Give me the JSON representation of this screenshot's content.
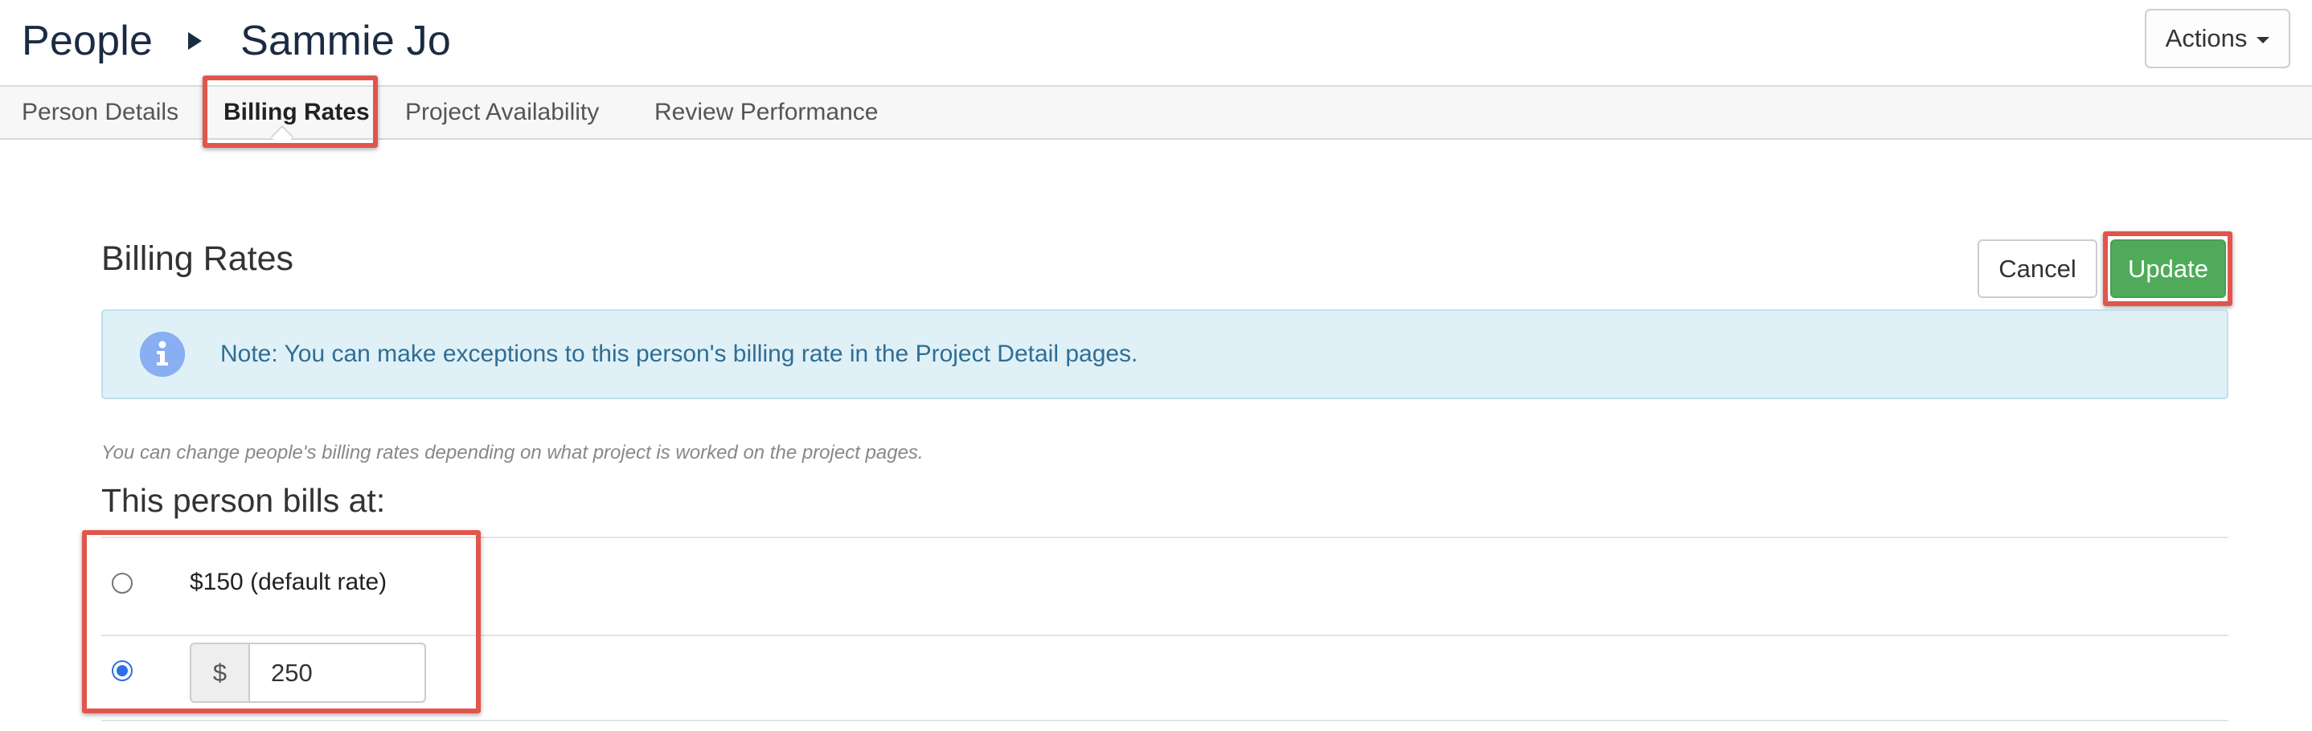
{
  "header": {
    "breadcrumb_root": "People",
    "breadcrumb_current": "Sammie Jo",
    "actions_label": "Actions"
  },
  "tabs": [
    {
      "label": "Person Details",
      "active": false
    },
    {
      "label": "Billing Rates",
      "active": true
    },
    {
      "label": "Project Availability",
      "active": false
    },
    {
      "label": "Review Performance",
      "active": false
    }
  ],
  "billing": {
    "title": "Billing Rates",
    "cancel_label": "Cancel",
    "update_label": "Update",
    "note": "Note: You can make exceptions to this person's billing rate in the Project Detail pages.",
    "hint": "You can change people's billing rates depending on what project is worked on the project pages.",
    "bills_heading": "This person bills at:",
    "default_rate_label": "$150 (default rate)",
    "currency_symbol": "$",
    "custom_rate_value": "250",
    "selected_option": "custom"
  },
  "colors": {
    "update_button": "#4fab5a",
    "highlight_border": "#e0564c",
    "alert_background": "#dff0f7",
    "alert_text": "#2f6e93",
    "radio_checked": "#2e6fe8",
    "breadcrumb_text": "#1b2b44"
  },
  "icons": {
    "breadcrumb_separator": "triangle-right-icon",
    "actions_caret": "caret-down-icon",
    "alert_icon": "info-icon"
  }
}
